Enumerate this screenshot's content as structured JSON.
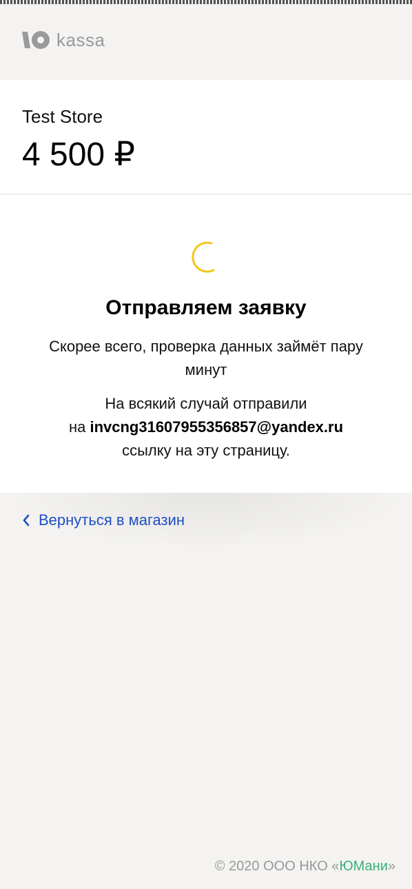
{
  "header": {
    "logo_text": "kassa",
    "logo_icon": "yoomoney-logo-icon"
  },
  "store": {
    "name": "Test Store",
    "amount": "4 500 ₽"
  },
  "status": {
    "title": "Отправляем заявку",
    "description": "Скорее всего, проверка данных займёт пару минут",
    "email_prefix_line": "На всякий случай отправили",
    "email_prefix": "на ",
    "email": "invcng31607955356857@yandex.ru",
    "email_suffix": "ссылку на эту страницу.",
    "spinner_color": "#f5c518"
  },
  "navigation": {
    "back_label": "Вернуться в магазин",
    "back_icon": "chevron-left-icon",
    "link_color": "#1e4fc2"
  },
  "footer": {
    "copyright_prefix": "© 2020  ООО НКО «",
    "brand": "ЮМани",
    "copyright_suffix": "»",
    "brand_color": "#3bb07a"
  }
}
